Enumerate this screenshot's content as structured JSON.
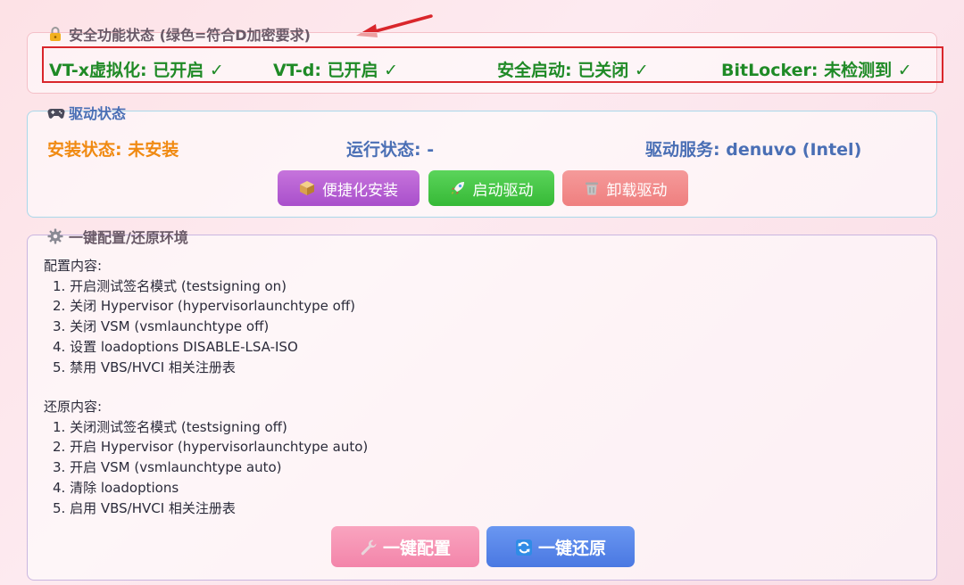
{
  "security": {
    "legend": "安全功能状态 (绿色=符合D加密要求)",
    "items": [
      {
        "label": "VT-x虚拟化: 已开启 ✓"
      },
      {
        "label": "VT-d: 已开启 ✓"
      },
      {
        "label": "安全启动: 已关闭 ✓"
      },
      {
        "label": "BitLocker: 未检测到 ✓"
      }
    ],
    "status_color": "#1f8a26",
    "highlight_color": "#d9262b"
  },
  "driver": {
    "legend": "驱动状态",
    "install_status": "安装状态: 未安装",
    "run_status": "运行状态: -",
    "service": "驱动服务: denuvo (Intel)",
    "install_color": "#f08a12",
    "info_color": "#4a6fb5",
    "buttons": {
      "install": "便捷化安装",
      "start": "启动驱动",
      "uninstall": "卸载驱动"
    }
  },
  "config": {
    "legend": "一键配置/还原环境",
    "config_title": "配置内容:",
    "config_items": [
      "1. 开启测试签名模式 (testsigning on)",
      "2. 关闭 Hypervisor (hypervisorlaunchtype off)",
      "3. 关闭 VSM (vsmlaunchtype off)",
      "4. 设置 loadoptions DISABLE-LSA-ISO",
      "5. 禁用 VBS/HVCI 相关注册表"
    ],
    "restore_title": "还原内容:",
    "restore_items": [
      "1. 关闭测试签名模式 (testsigning off)",
      "2. 开启 Hypervisor (hypervisorlaunchtype auto)",
      "3. 开启 VSM (vsmlaunchtype auto)",
      "4. 清除 loadoptions",
      "5. 启用 VBS/HVCI 相关注册表"
    ],
    "buttons": {
      "configure": "一键配置",
      "restore": "一键还原"
    }
  }
}
